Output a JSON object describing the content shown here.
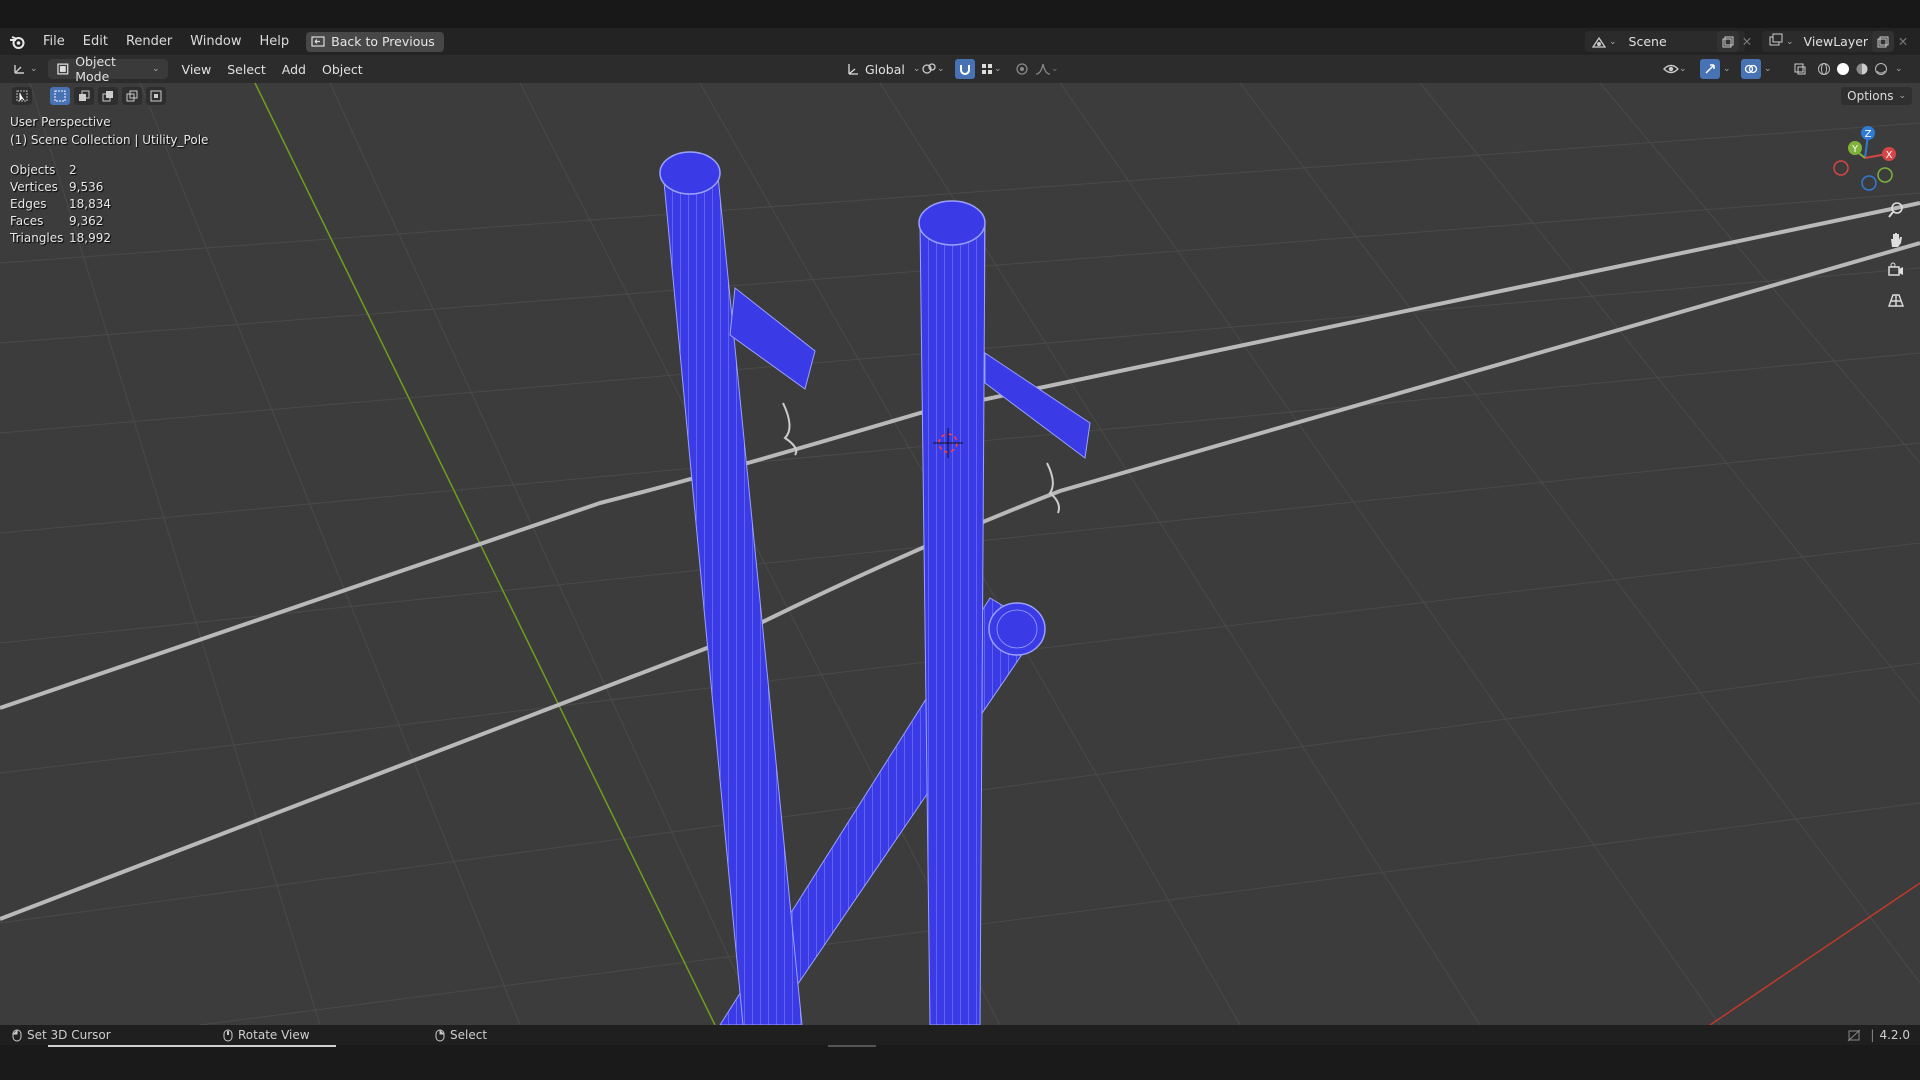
{
  "menubar": {
    "items": [
      "File",
      "Edit",
      "Render",
      "Window",
      "Help"
    ],
    "back_button": "Back to Previous",
    "scene": "Scene",
    "view_layer": "ViewLayer"
  },
  "header": {
    "mode": "Object Mode",
    "menus": [
      "View",
      "Select",
      "Add",
      "Object"
    ],
    "transform_orientation": "Global"
  },
  "viewport": {
    "perspective": "User Perspective",
    "collection": "(1) Scene Collection | Utility_Pole",
    "options_label": "Options",
    "stats": [
      {
        "label": "Objects",
        "value": "2"
      },
      {
        "label": "Vertices",
        "value": "9,536"
      },
      {
        "label": "Edges",
        "value": "18,834"
      },
      {
        "label": "Faces",
        "value": "9,362"
      },
      {
        "label": "Triangles",
        "value": "18,992"
      }
    ],
    "gizmo_axes": {
      "x": "X",
      "y": "Y",
      "z": "Z"
    },
    "colors": {
      "mesh": "#3a3ae6",
      "wire": "#9aa0ff",
      "grid": "#464646",
      "x_axis": "#c0392b",
      "y_axis": "#6f9e1e"
    }
  },
  "statusbar": {
    "left": "Set 3D Cursor",
    "middle": "Rotate View",
    "right": "Select",
    "version": "4.2.0"
  }
}
